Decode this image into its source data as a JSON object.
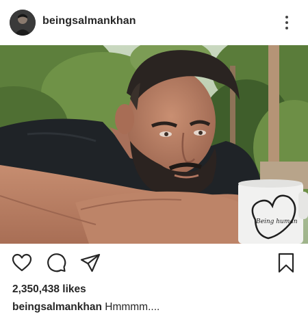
{
  "post": {
    "username": "beingsalmankhan",
    "likes_text": "2,350,438 likes",
    "caption_user": "beingsalmankhan",
    "caption_text": "Hmmmm...."
  },
  "photo": {
    "mug_text": "Being human"
  },
  "icons": {
    "more": "more-vertical-icon",
    "like": "heart-icon",
    "comment": "comment-icon",
    "share": "send-icon",
    "save": "bookmark-icon"
  }
}
